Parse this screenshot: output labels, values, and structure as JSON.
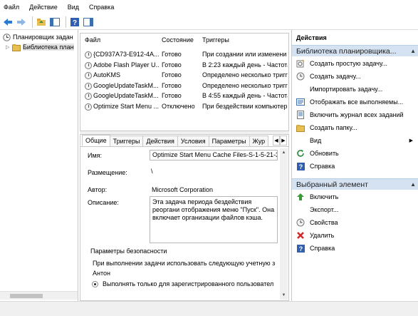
{
  "menu": [
    "Файл",
    "Действие",
    "Вид",
    "Справка"
  ],
  "tree": {
    "root_label": "Планировщик задан",
    "library_label": "Библиотека план"
  },
  "tasks": {
    "columns": [
      "Файл",
      "Состояние",
      "Триггеры"
    ],
    "rows": [
      {
        "name": "{CD937A73-E912-4A...",
        "status": "Готово",
        "trigger": "При создании или изменени"
      },
      {
        "name": "Adobe Flash Player U...",
        "status": "Готово",
        "trigger": "В 2:23 каждый день - Частота"
      },
      {
        "name": "AutoKMS",
        "status": "Готово",
        "trigger": "Определено несколько тригг"
      },
      {
        "name": "GoogleUpdateTaskM...",
        "status": "Готово",
        "trigger": "Определено несколько тригг"
      },
      {
        "name": "GoogleUpdateTaskM...",
        "status": "Готово",
        "trigger": "В 4:55 каждый день - Частота"
      },
      {
        "name": "Optimize Start Menu ...",
        "status": "Отключено",
        "trigger": "При бездействии компьютер"
      }
    ]
  },
  "details": {
    "tabs": [
      "Общие",
      "Триггеры",
      "Действия",
      "Условия",
      "Параметры",
      "Жур"
    ],
    "name_label": "Имя:",
    "name_value": "Optimize Start Menu Cache Files-S-1-5-21-3",
    "location_label": "Размещение:",
    "location_value": "\\",
    "author_label": "Автор:",
    "author_value": "Microsoft Corporation",
    "description_label": "Описание:",
    "description_value": "Эта задача периода бездействия реоргани отображения меню \"Пуск\". Она включает организации файлов кэша.",
    "security_heading": "Параметры безопасности",
    "account_text": "При выполнении задачи использовать следующую учетную з",
    "account_user": "Антон",
    "run_option": "Выполнять только для зарегистрированного пользовател"
  },
  "actions": {
    "title": "Действия",
    "section1": "Библиотека планировщика...",
    "items1": [
      {
        "label": "Создать простую задачу...",
        "icon": "wand-icon"
      },
      {
        "label": "Создать задачу...",
        "icon": "clock-icon"
      },
      {
        "label": "Импортировать задачу...",
        "icon": ""
      },
      {
        "label": "Отображать все выполняемы...",
        "icon": "list-icon"
      },
      {
        "label": "Включить журнал всех заданий",
        "icon": "log-icon"
      },
      {
        "label": "Создать папку...",
        "icon": "folder-icon"
      },
      {
        "label": "Вид",
        "icon": ""
      },
      {
        "label": "Обновить",
        "icon": "refresh-icon"
      },
      {
        "label": "Справка",
        "icon": "help-icon"
      }
    ],
    "section2": "Выбранный элемент",
    "items2": [
      {
        "label": "Включить",
        "icon": "enable-icon"
      },
      {
        "label": "Экспорт...",
        "icon": ""
      },
      {
        "label": "Свойства",
        "icon": "properties-icon"
      },
      {
        "label": "Удалить",
        "icon": "delete-icon"
      },
      {
        "label": "Справка",
        "icon": "help-icon"
      }
    ]
  },
  "colors": {
    "section_bg": "#d5e2f1",
    "accent": "#1e5aa8"
  }
}
